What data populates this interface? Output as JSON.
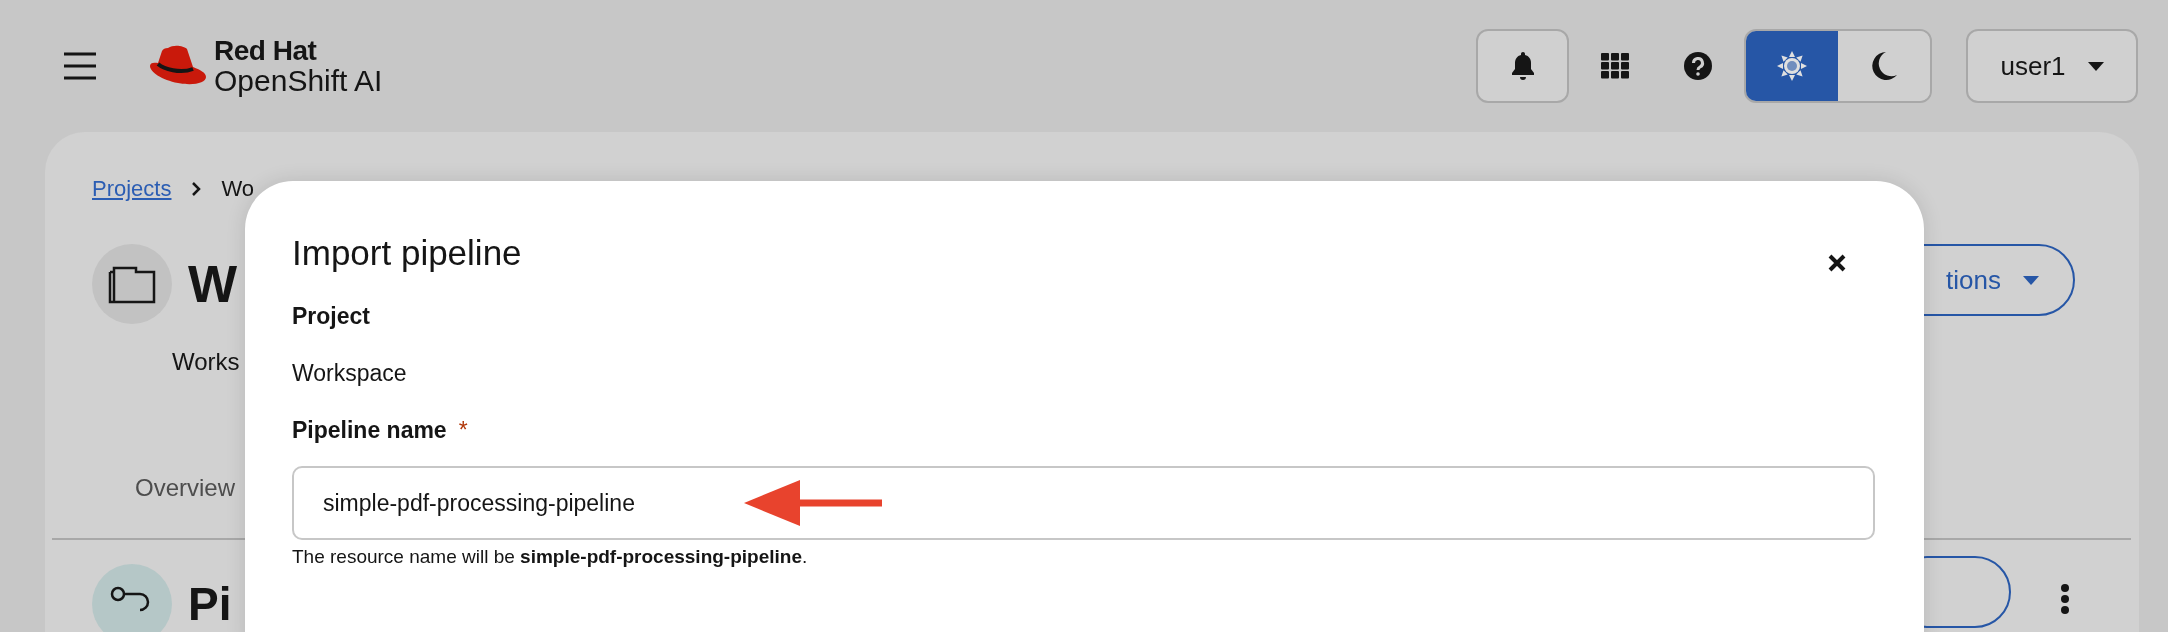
{
  "header": {
    "brand": {
      "line1": "Red Hat",
      "line2": "OpenShift AI"
    },
    "theme": [
      {
        "kind": "light",
        "selected": true
      },
      {
        "kind": "dark",
        "selected": false
      }
    ],
    "user": "user1"
  },
  "page": {
    "breadcrumb": [
      {
        "label": "Projects",
        "kind": "link"
      },
      {
        "label": "Wo",
        "kind": "current"
      }
    ],
    "title": "W",
    "description": "Works",
    "tabs": [
      {
        "label": "Overview"
      }
    ],
    "actions": "tions",
    "section_title": "Pi"
  },
  "modal": {
    "title": "Import pipeline",
    "fields": [
      {
        "kind": "static",
        "label": "Project",
        "value": "Workspace"
      },
      {
        "kind": "input",
        "label": "Pipeline name",
        "required_mark": "*",
        "value": "simple-pdf-processing-pipeline",
        "helper": "The resource name will be **simple-pdf-processing-pipeline**."
      }
    ]
  }
}
